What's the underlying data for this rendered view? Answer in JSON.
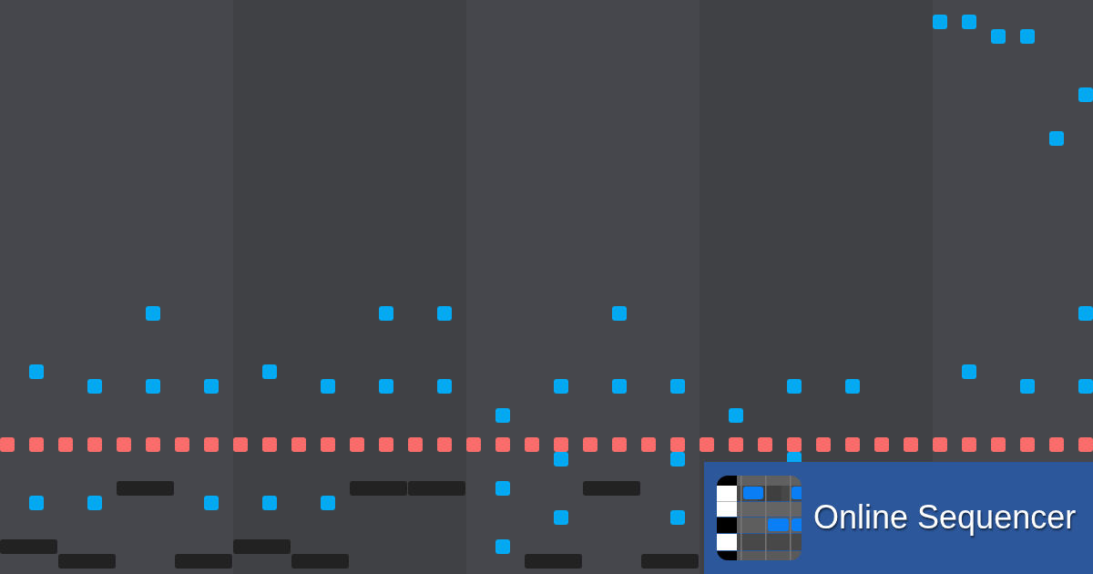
{
  "banner": {
    "title": "Online Sequencer"
  }
}
